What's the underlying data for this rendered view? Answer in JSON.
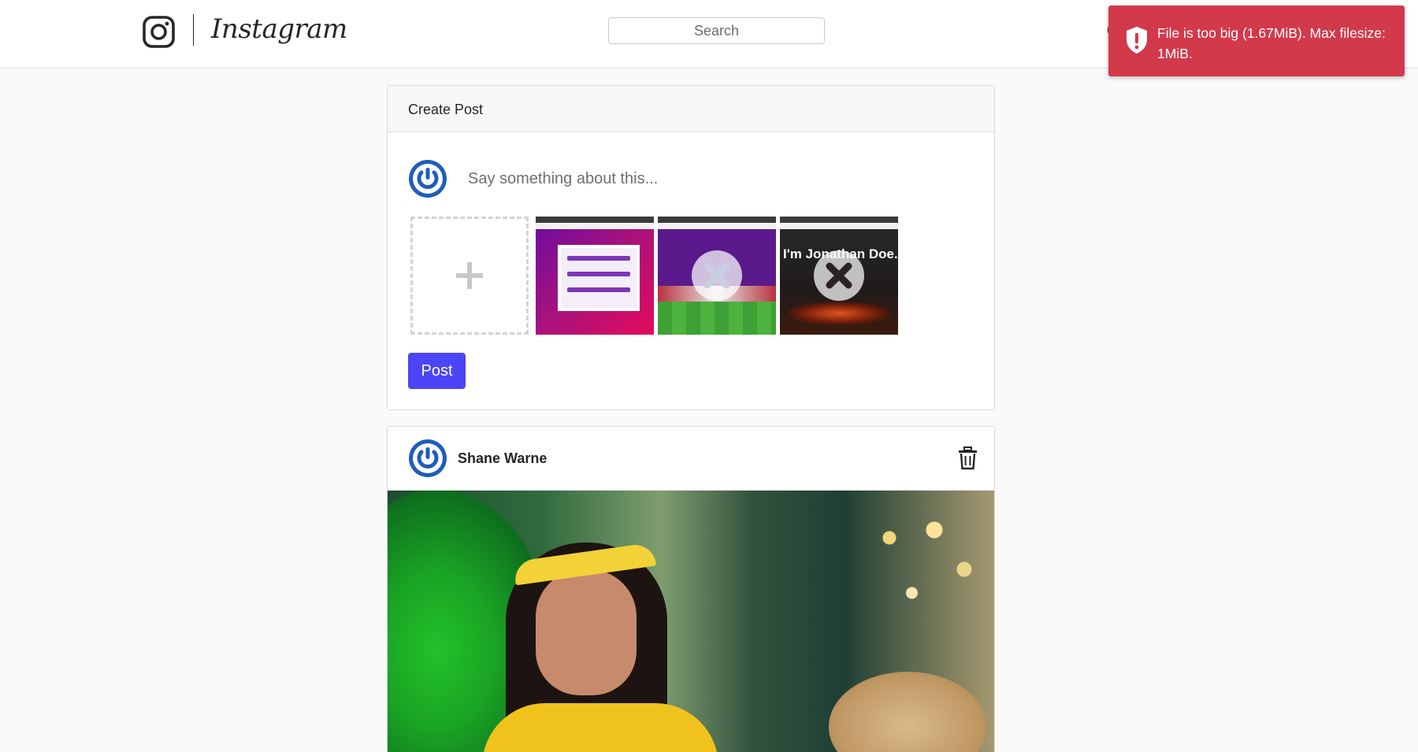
{
  "header": {
    "brand": "Instagram",
    "search_placeholder": "Search",
    "nav_icons": [
      "compass-icon",
      "heart-icon",
      "user-icon"
    ]
  },
  "toast": {
    "message": "File is too big (1.67MiB). Max filesize: 1MiB.",
    "icon": "shield-alert-icon",
    "color": "#d2394b"
  },
  "create_post": {
    "title": "Create Post",
    "placeholder": "Say something about this...",
    "add_icon": "plus-icon",
    "thumbnails": [
      {
        "caption": "",
        "has_remove": false
      },
      {
        "caption": "",
        "has_remove": true
      },
      {
        "caption": "I'm Jonathan Doe.",
        "has_remove": true
      }
    ],
    "post_label": "Post",
    "post_color": "#4c45f5"
  },
  "feed": {
    "author": "Shane Warne",
    "delete_icon": "trash-icon"
  }
}
